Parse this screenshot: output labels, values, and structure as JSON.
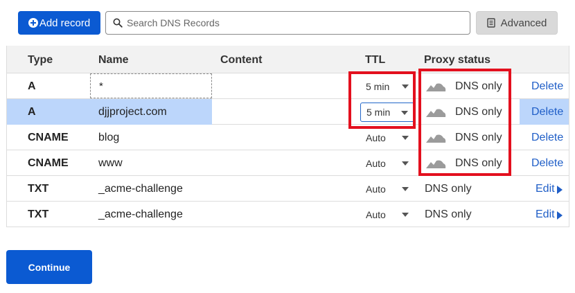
{
  "toolbar": {
    "add_record_label": "Add record",
    "search_placeholder": "Search DNS Records",
    "advanced_label": "Advanced"
  },
  "table": {
    "headers": {
      "type": "Type",
      "name": "Name",
      "content": "Content",
      "ttl": "TTL",
      "proxy_status": "Proxy status"
    },
    "rows": [
      {
        "type": "A",
        "name": "*",
        "ttl": "5 min",
        "proxy": "DNS only",
        "action": "Delete"
      },
      {
        "type": "A",
        "name": "djjproject.com",
        "ttl": "5 min",
        "proxy": "DNS only",
        "action": "Delete"
      },
      {
        "type": "CNAME",
        "name": "blog",
        "ttl": "Auto",
        "proxy": "DNS only",
        "action": "Delete"
      },
      {
        "type": "CNAME",
        "name": "www",
        "ttl": "Auto",
        "proxy": "DNS only",
        "action": "Delete"
      },
      {
        "type": "TXT",
        "name": "_acme-challenge",
        "ttl": "Auto",
        "proxy": "DNS only",
        "action": "Edit"
      },
      {
        "type": "TXT",
        "name": "_acme-challenge",
        "ttl": "Auto",
        "proxy": "DNS only",
        "action": "Edit"
      }
    ]
  },
  "footer": {
    "continue_label": "Continue"
  },
  "colors": {
    "primary": "#0b5ad2",
    "selection": "#bcd6fb",
    "annotation": "#e3101e",
    "link": "#1f5ec7"
  },
  "icons": {
    "add": "plus-circle-icon",
    "search": "search-icon",
    "advanced": "document-icon",
    "proxy": "cloud-icon",
    "ttl_dropdown": "chevron-down-icon",
    "edit": "triangle-right-icon"
  }
}
